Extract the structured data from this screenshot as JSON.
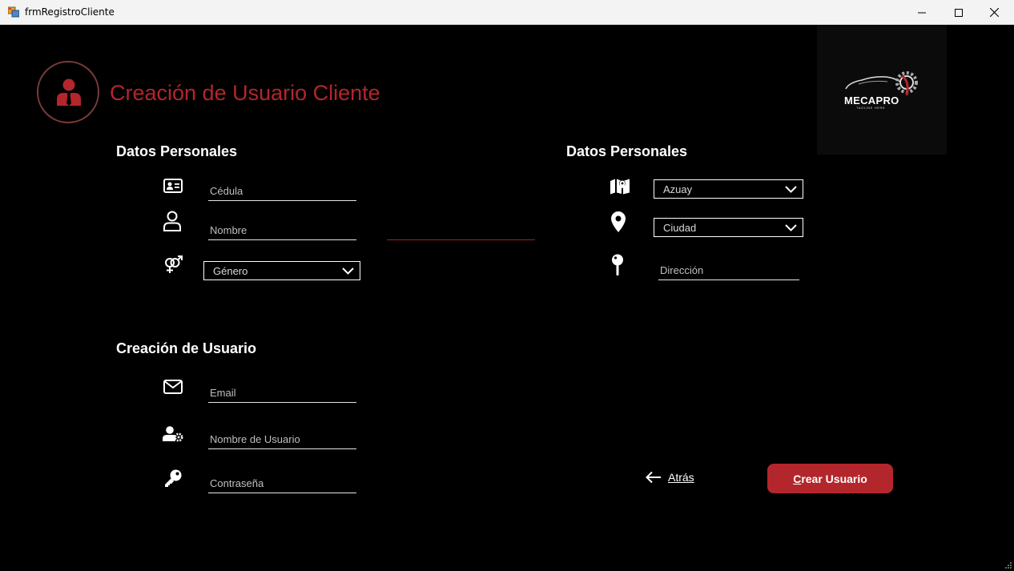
{
  "window": {
    "title": "frmRegistroCliente"
  },
  "header": {
    "title": "Creación de Usuario Cliente"
  },
  "logo": {
    "brand": "MECAPRO",
    "tagline": "TAGLINE HERE"
  },
  "personal": {
    "title": "Datos Personales",
    "cedula_placeholder": "Cédula",
    "nombre_placeholder": "Nombre",
    "genero_value": "Género"
  },
  "location": {
    "title": "Datos Personales",
    "provincia_value": "Azuay",
    "ciudad_value": "Ciudad",
    "direccion_placeholder": "Dirección"
  },
  "account": {
    "title": "Creación de Usuario",
    "email_placeholder": "Email",
    "username_placeholder": "Nombre de Usuario",
    "password_placeholder": "Contraseña"
  },
  "actions": {
    "back_label": "Atrás",
    "create_label": "Crear Usuario"
  },
  "colors": {
    "accent": "#b3262b",
    "background": "#000000",
    "titlebar": "#f3f3f3"
  }
}
